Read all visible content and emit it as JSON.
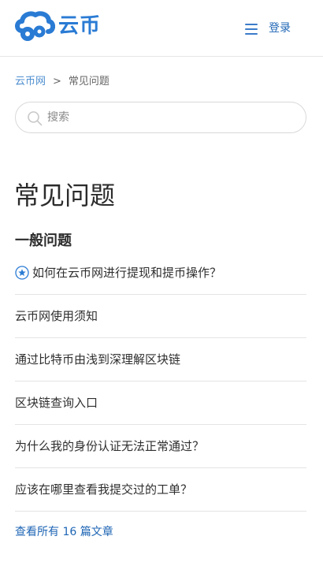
{
  "header": {
    "logo_text": "云币",
    "logo_icon": "cloud-icon",
    "menu_icon": "hamburger-icon",
    "login_label": "登录",
    "brand_color": "#2a7bd4"
  },
  "breadcrumb": {
    "home": "云币网",
    "separator": ">",
    "current": "常见问题"
  },
  "search": {
    "placeholder": "搜索",
    "icon": "search-icon"
  },
  "page_title": "常见问题",
  "section": {
    "title": "一般问题",
    "articles": [
      {
        "title": "如何在云币网进行提现和提币操作？",
        "promoted": true,
        "icon": "star-icon"
      },
      {
        "title": "云币网使用须知",
        "promoted": false
      },
      {
        "title": "通过比特币由浅到深理解区块链",
        "promoted": false
      },
      {
        "title": "区块链查询入口",
        "promoted": false
      },
      {
        "title": "为什么我的身份认证无法正常通过？",
        "promoted": false
      },
      {
        "title": "应该在哪里查看我提交过的工单？",
        "promoted": false
      }
    ],
    "see_all": "查看所有 16 篇文章"
  }
}
